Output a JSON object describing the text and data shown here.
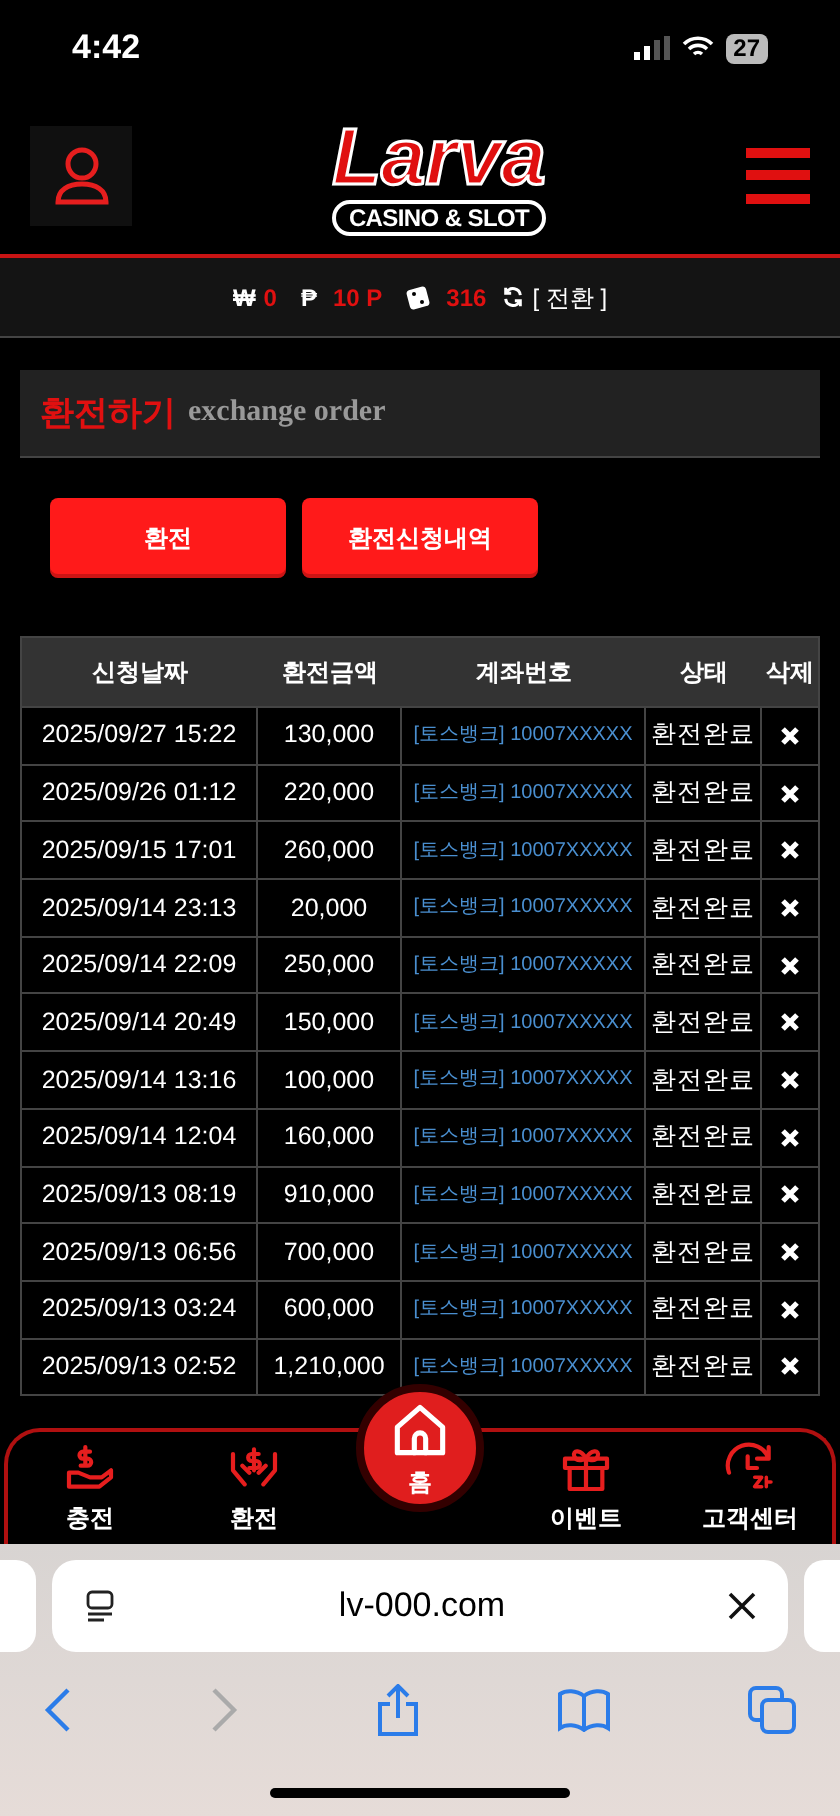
{
  "status_bar": {
    "time": "4:42",
    "battery": "27"
  },
  "header": {
    "logo_title": "Larva",
    "logo_subtitle": "CASINO & SLOT"
  },
  "balance": {
    "cash_symbol": "₩",
    "cash": "0",
    "point_symbol": "₱",
    "point": "10 P",
    "chip": "316",
    "convert": "[ 전환 ]"
  },
  "page_title": {
    "title": "환전하기",
    "subtitle": "exchange order"
  },
  "actions": [
    {
      "label": "환전"
    },
    {
      "label": "환전신청내역"
    }
  ],
  "table": {
    "columns": [
      "신청날짜",
      "환전금액",
      "계좌번호",
      "상태",
      "삭제"
    ],
    "rows": [
      {
        "date": "2025/09/27 15:22",
        "amount": "130,000",
        "account": "[토스뱅크] 10007XXXXX",
        "status": "환전완료"
      },
      {
        "date": "2025/09/26 01:12",
        "amount": "220,000",
        "account": "[토스뱅크] 10007XXXXX",
        "status": "환전완료"
      },
      {
        "date": "2025/09/15 17:01",
        "amount": "260,000",
        "account": "[토스뱅크] 10007XXXXX",
        "status": "환전완료"
      },
      {
        "date": "2025/09/14 23:13",
        "amount": "20,000",
        "account": "[토스뱅크] 10007XXXXX",
        "status": "환전완료"
      },
      {
        "date": "2025/09/14 22:09",
        "amount": "250,000",
        "account": "[토스뱅크] 10007XXXXX",
        "status": "환전완료"
      },
      {
        "date": "2025/09/14 20:49",
        "amount": "150,000",
        "account": "[토스뱅크] 10007XXXXX",
        "status": "환전완료"
      },
      {
        "date": "2025/09/14 13:16",
        "amount": "100,000",
        "account": "[토스뱅크] 10007XXXXX",
        "status": "환전완료"
      },
      {
        "date": "2025/09/14 12:04",
        "amount": "160,000",
        "account": "[토스뱅크] 10007XXXXX",
        "status": "환전완료"
      },
      {
        "date": "2025/09/13 08:19",
        "amount": "910,000",
        "account": "[토스뱅크] 10007XXXXX",
        "status": "환전완료"
      },
      {
        "date": "2025/09/13 06:56",
        "amount": "700,000",
        "account": "[토스뱅크] 10007XXXXX",
        "status": "환전완료"
      },
      {
        "date": "2025/09/13 03:24",
        "amount": "600,000",
        "account": "[토스뱅크] 10007XXXXX",
        "status": "환전완료"
      },
      {
        "date": "2025/09/13 02:52",
        "amount": "1,210,000",
        "account": "[토스뱅크] 10007XXXXX",
        "status": "환전완료"
      }
    ]
  },
  "bottom_nav": [
    {
      "kind": "deposit",
      "label": "충전",
      "selected": false
    },
    {
      "kind": "withdraw",
      "label": "환전",
      "selected": false
    },
    {
      "kind": "home",
      "label": "홈",
      "selected": true
    },
    {
      "kind": "gift",
      "label": "이벤트",
      "selected": false
    },
    {
      "kind": "support",
      "label": "고객센터",
      "selected": false
    }
  ],
  "browser": {
    "url": "lv-000.com",
    "back_disabled": false,
    "forward_disabled": true
  }
}
